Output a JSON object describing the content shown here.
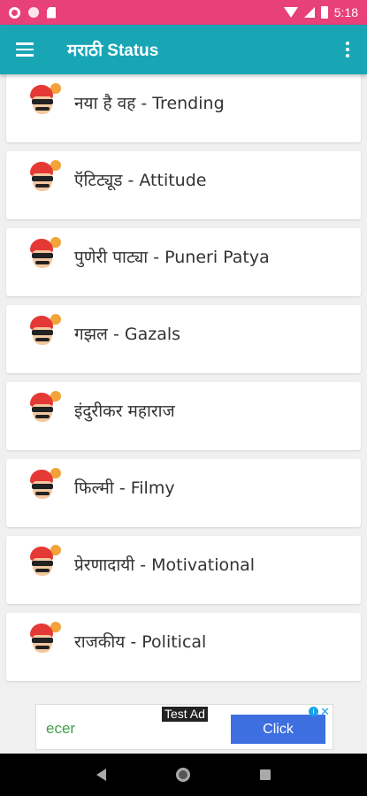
{
  "status_bar": {
    "time": "5:18",
    "icons": [
      "gear-icon",
      "circle-icon",
      "sd-card-icon",
      "wifi-icon",
      "signal-icon",
      "battery-icon"
    ]
  },
  "app_bar": {
    "title": "मराठी Status",
    "menu_icon": "hamburger-menu-icon",
    "overflow_icon": "overflow-menu-icon",
    "color": "#18a6b5"
  },
  "categories": [
    {
      "label": "नया है वह - Trending"
    },
    {
      "label": "ऍटिट्यूड - Attitude"
    },
    {
      "label": "पुणेरी पाट्या - Puneri Patya"
    },
    {
      "label": "गझल - Gazals"
    },
    {
      "label": "इंदुरीकर महाराज"
    },
    {
      "label": "फिल्मी - Filmy"
    },
    {
      "label": "प्रेरणादायी - Motivational"
    },
    {
      "label": "राजकीय - Political"
    }
  ],
  "ad": {
    "tag": "Test Ad",
    "brand": "ecer",
    "button_label": "Click",
    "info": "i",
    "close": "✕"
  },
  "colors": {
    "status_bar": "#e8417a",
    "app_bar": "#18a6b5",
    "ad_button": "#3d6fe0",
    "ad_brand": "#43a047"
  }
}
